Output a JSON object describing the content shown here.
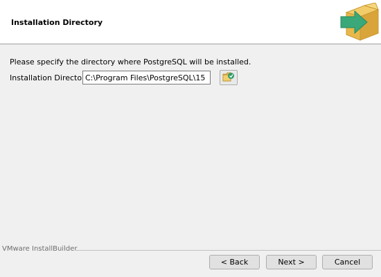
{
  "header": {
    "title": "Installation Directory",
    "logo_icon": "installer-box-arrow-icon",
    "colors": {
      "box": "#e8b94a",
      "arrow": "#3aa878"
    }
  },
  "main": {
    "description": "Please specify the directory where PostgreSQL will be installed.",
    "directory_label": "Installation Directory",
    "directory_value": "C:\\Program Files\\PostgreSQL\\15",
    "browse_icon": "folder-browse-icon"
  },
  "footer": {
    "brand": "VMware InstallBuilder",
    "back_label": "< Back",
    "next_label": "Next >",
    "cancel_label": "Cancel"
  }
}
